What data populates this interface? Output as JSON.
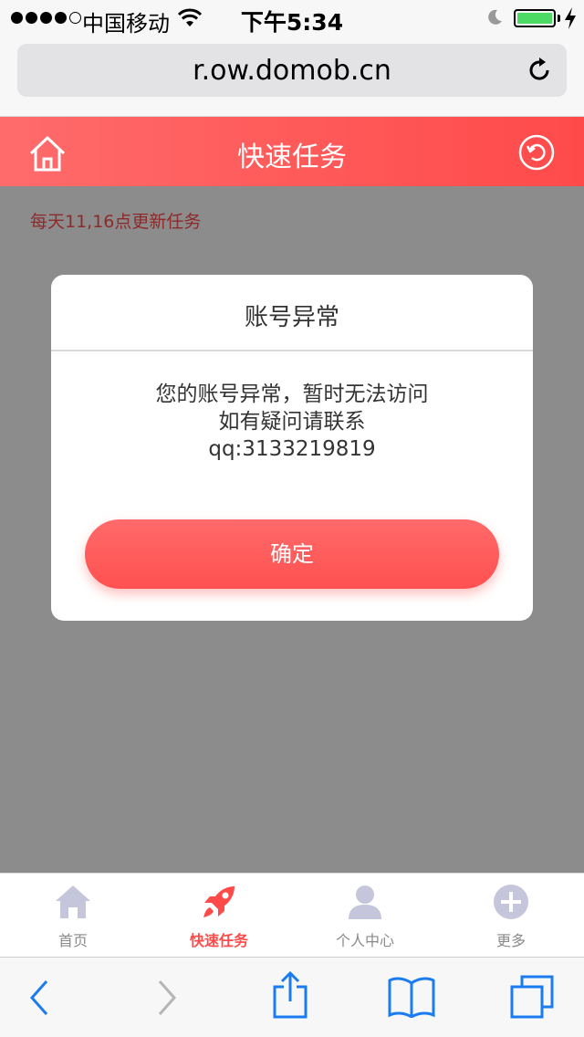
{
  "status_bar": {
    "carrier": "中国移动",
    "time": "下午5:34",
    "battery_color": "#4cd964"
  },
  "browser": {
    "url": "r.ow.domob.cn"
  },
  "header": {
    "title": "快速任务",
    "bg_color": "#ff4a4a",
    "left_icon": "home-icon",
    "right_icon": "refresh-icon"
  },
  "content": {
    "notice": "每天11,16点更新任务"
  },
  "modal": {
    "title": "账号异常",
    "line1": "您的账号异常，暂时无法访问",
    "line2": "如有疑问请联系",
    "line3": "qq:3133219819",
    "button_label": "确定"
  },
  "tab_bar": {
    "items": [
      {
        "label": "首页",
        "icon": "home-icon",
        "active": false
      },
      {
        "label": "快速任务",
        "icon": "rocket-icon",
        "active": true
      },
      {
        "label": "个人中心",
        "icon": "user-icon",
        "active": false
      },
      {
        "label": "更多",
        "icon": "plus-circle-icon",
        "active": false
      }
    ],
    "active_color": "#ff4a4a",
    "inactive_icon_color": "#c5c5dc"
  },
  "toolbar": {
    "tint_color": "#1a7cf0"
  }
}
